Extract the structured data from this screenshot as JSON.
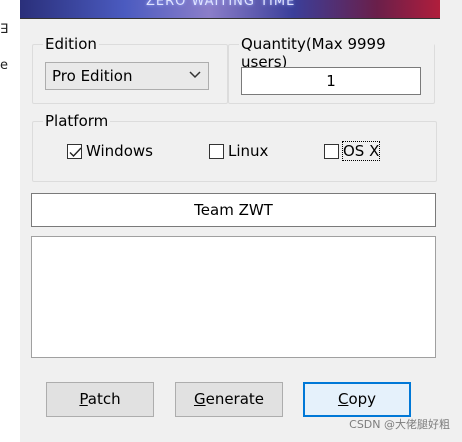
{
  "edge_letters": [
    "∃",
    "e"
  ],
  "banner": {
    "text": "ZERO WAITING TIME"
  },
  "edition": {
    "legend": "Edition",
    "selected": "Pro Edition"
  },
  "quantity": {
    "legend": "Quantity(Max 9999 users)",
    "value": "1"
  },
  "platform": {
    "legend": "Platform",
    "options": [
      {
        "label": "Windows",
        "checked": true
      },
      {
        "label": "Linux",
        "checked": false
      },
      {
        "label": "OS X",
        "checked": false
      }
    ]
  },
  "name_field": {
    "value": "Team ZWT"
  },
  "output_area": {
    "value": ""
  },
  "buttons": {
    "patch": {
      "label": "Patch",
      "mnemonic": "P",
      "rest": "atch"
    },
    "generate": {
      "label": "Generate",
      "mnemonic": "G",
      "rest": "enerate"
    },
    "copy": {
      "label": "Copy",
      "mnemonic": "C",
      "rest": "opy"
    }
  },
  "watermark": "CSDN @大佬腿好粗"
}
